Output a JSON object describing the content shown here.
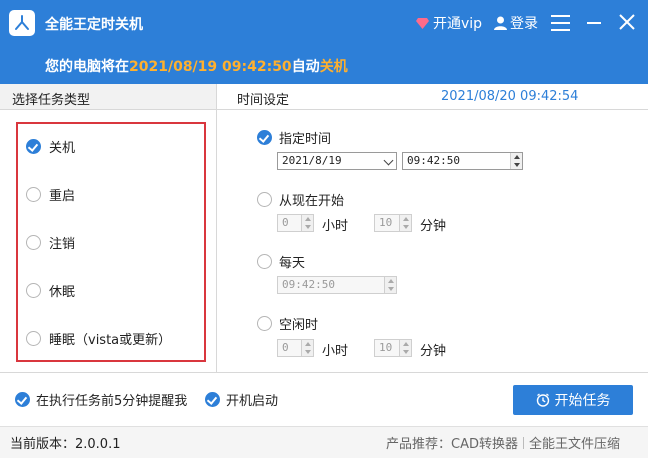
{
  "title_bar": {
    "app_title": "全能王定时关机",
    "vip_label": "开通vip",
    "login_label": "登录"
  },
  "banner": {
    "prefix": "您的电脑将在",
    "datetime": "2021/08/19 09:42:50",
    "middle": "自动",
    "action": "关机"
  },
  "task_panel": {
    "header": "选择任务类型",
    "tasks": [
      {
        "label": "关机",
        "selected": true
      },
      {
        "label": "重启",
        "selected": false
      },
      {
        "label": "注销",
        "selected": false
      },
      {
        "label": "休眠",
        "selected": false
      },
      {
        "label": "睡眠（vista或更新）",
        "selected": false
      }
    ]
  },
  "time_panel": {
    "header": "时间设定",
    "current_time": "2021/08/20 09:42:54",
    "specific_time": {
      "label": "指定时间",
      "selected": true,
      "date_value": "2021/8/19",
      "time_value": "09:42:50"
    },
    "from_now": {
      "label": "从现在开始",
      "selected": false,
      "hours_value": "0",
      "hours_unit": "小时",
      "minutes_value": "10",
      "minutes_unit": "分钟"
    },
    "daily": {
      "label": "每天",
      "selected": false,
      "time_value": "09:42:50"
    },
    "idle": {
      "label": "空闲时",
      "selected": false,
      "hours_value": "0",
      "hours_unit": "小时",
      "minutes_value": "10",
      "minutes_unit": "分钟"
    }
  },
  "options": {
    "remind_label": "在执行任务前5分钟提醒我",
    "remind_checked": true,
    "autostart_label": "开机启动",
    "autostart_checked": true,
    "start_button": "开始任务"
  },
  "footer": {
    "version_label": "当前版本：2.0.0.1",
    "recommend_label": "产品推荐：",
    "link1": "CAD转换器",
    "link2": "全能王文件压缩"
  },
  "colors": {
    "brand_blue": "#2d7fd8",
    "highlight_orange": "#ffb02e",
    "frame_red": "#d9363e"
  }
}
